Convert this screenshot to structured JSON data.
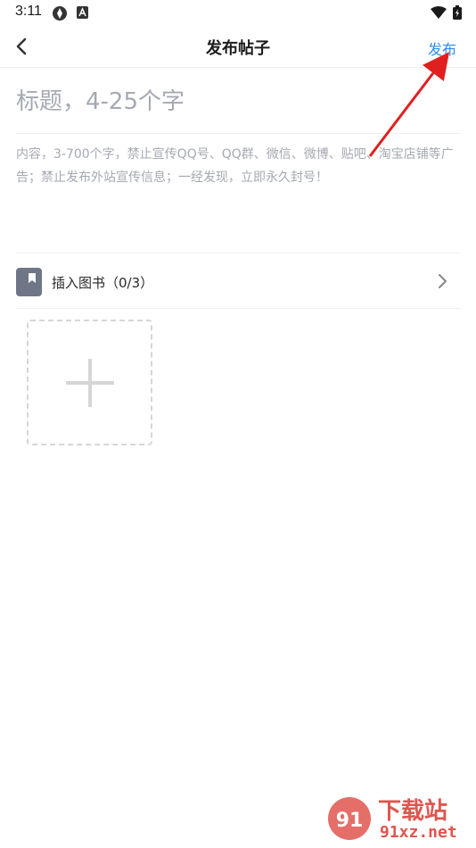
{
  "status_bar": {
    "time": "3:11"
  },
  "nav": {
    "title": "发布帖子",
    "publish_label": "发布"
  },
  "form": {
    "title_placeholder": "标题，4-25个字",
    "content_placeholder": "内容，3-700个字，禁止宣传QQ号、QQ群、微信、微博、贴吧、淘宝店铺等广告；禁止发布外站宣传信息；一经发现，立即永久封号！"
  },
  "insert_book": {
    "label": "插入图书（0/3）"
  },
  "watermark": {
    "brand": "下载站",
    "domain": "91xz.net"
  },
  "colors": {
    "accent": "#2d8cf0",
    "annotation_arrow": "#e02020",
    "watermark": "#e0554f"
  },
  "icons": {
    "back": "chevron-left-icon",
    "book": "bookmark-icon",
    "chevron": "chevron-right-icon",
    "add": "plus-icon"
  }
}
